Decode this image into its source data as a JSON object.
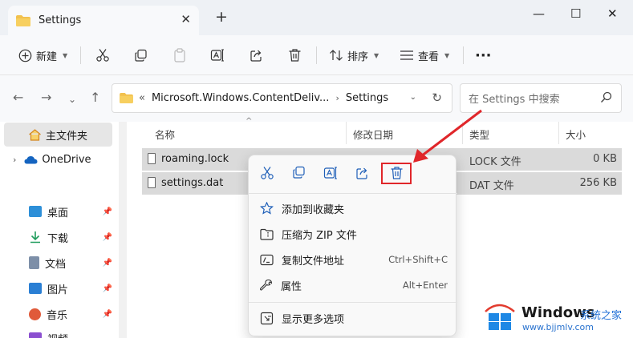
{
  "window": {
    "tab_title": "Settings",
    "tab_close": "✕",
    "new_tab": "+",
    "minimize": "—",
    "maximize": "☐",
    "close": "✕"
  },
  "toolbar": {
    "new_label": "新建",
    "sort_label": "排序",
    "view_label": "查看",
    "more": "···"
  },
  "address": {
    "prefix": "«",
    "path_1": "Microsoft.Windows.ContentDeliv...",
    "path_2": "Settings",
    "search_placeholder": "在 Settings 中搜索"
  },
  "sidebar": {
    "items": [
      {
        "label": "主文件夹"
      },
      {
        "label": "OneDrive"
      },
      {
        "label": "桌面"
      },
      {
        "label": "下载"
      },
      {
        "label": "文档"
      },
      {
        "label": "图片"
      },
      {
        "label": "音乐"
      },
      {
        "label": "视频"
      }
    ]
  },
  "columns": {
    "name": "名称",
    "date": "修改日期",
    "type": "类型",
    "size": "大小"
  },
  "files": [
    {
      "name": "roaming.lock",
      "type": "LOCK 文件",
      "size": "0 KB"
    },
    {
      "name": "settings.dat",
      "type": "DAT 文件",
      "size": "256 KB"
    }
  ],
  "context_menu": {
    "items": [
      {
        "label": "添加到收藏夹",
        "shortcut": ""
      },
      {
        "label": "压缩为 ZIP 文件",
        "shortcut": ""
      },
      {
        "label": "复制文件地址",
        "shortcut": "Ctrl+Shift+C"
      },
      {
        "label": "属性",
        "shortcut": "Alt+Enter"
      },
      {
        "label": "显示更多选项",
        "shortcut": ""
      }
    ]
  },
  "watermark": {
    "title": "Windows",
    "subtitle": "系统之家",
    "url": "www.bjjmlv.com"
  },
  "colors": {
    "accent_blue": "#1f6fd6",
    "highlight_red": "#e0262a",
    "folder_yellow": "#f2c14e"
  }
}
